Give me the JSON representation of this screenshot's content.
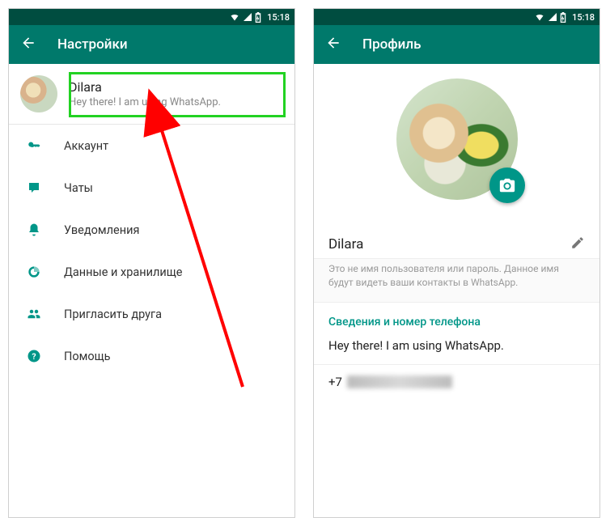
{
  "status": {
    "time": "15:18"
  },
  "left": {
    "title": "Настройки",
    "profile": {
      "name": "Dilara",
      "status": "Hey there! I am using WhatsApp."
    },
    "items": [
      {
        "icon": "key",
        "label": "Аккаунт"
      },
      {
        "icon": "chat",
        "label": "Чаты"
      },
      {
        "icon": "bell",
        "label": "Уведомления"
      },
      {
        "icon": "data",
        "label": "Данные и хранилище"
      },
      {
        "icon": "invite",
        "label": "Пригласить друга"
      },
      {
        "icon": "help",
        "label": "Помощь"
      }
    ]
  },
  "right": {
    "title": "Профиль",
    "name": "Dilara",
    "hint": "Это не имя пользователя или пароль. Данное имя будут видеть ваши контакты в WhatsApp.",
    "sectionTitle": "Сведения и номер телефона",
    "about": "Hey there! I am using WhatsApp.",
    "phonePrefix": "+7"
  }
}
